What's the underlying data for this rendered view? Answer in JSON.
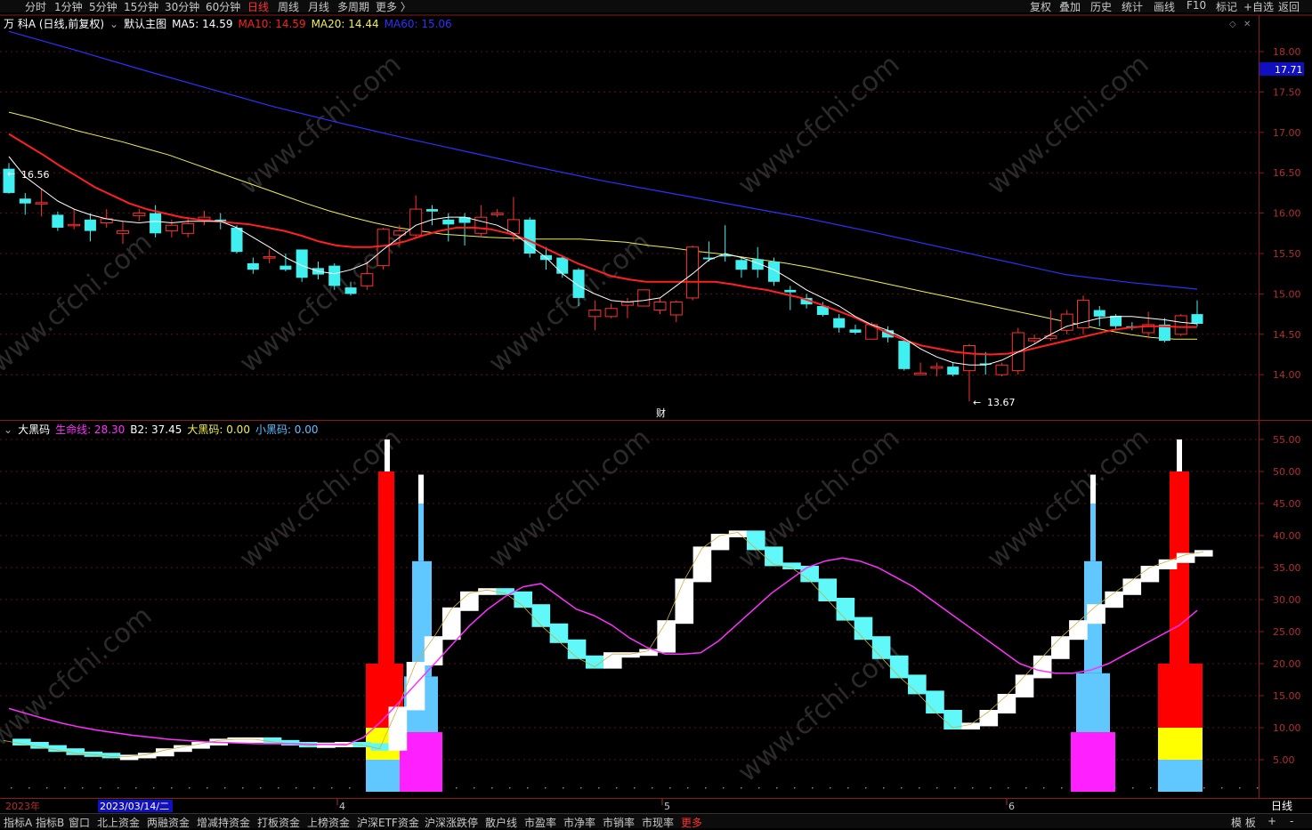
{
  "topbar": {
    "left": [
      "分时",
      "1分钟",
      "5分钟",
      "15分钟",
      "30分钟",
      "60分钟",
      "日线",
      "周线",
      "月线",
      "多周期",
      "更多 〉"
    ],
    "active": "日线",
    "right": [
      "复权",
      "叠加",
      "历史",
      "统计",
      "画线",
      "F10",
      "标记",
      "+自选",
      "返回"
    ]
  },
  "main_info": {
    "stock": "万 科A (日线,前复权)",
    "template": "默认主图",
    "ma5": "MA5: 14.59",
    "ma10": "MA10: 14.59",
    "ma20": "MA20: 14.44",
    "ma60": "MA60: 15.06"
  },
  "sub_info": {
    "name": "大黑码",
    "life": "生命线: 28.30",
    "b2": "B2: 37.45",
    "big": "大黑码: 0.00",
    "small": "小黑码: 0.00"
  },
  "price_axis": [
    "18.00",
    "17.50",
    "17.00",
    "16.50",
    "16.00",
    "15.50",
    "15.00",
    "14.50",
    "14.00"
  ],
  "price_tag": "17.71",
  "ind_axis": [
    "55.00",
    "50.00",
    "45.00",
    "40.00",
    "35.00",
    "30.00",
    "25.00",
    "20.00",
    "15.00",
    "10.00",
    "5.00"
  ],
  "annotations": {
    "high": "16.56",
    "low": "13.67",
    "fin": "财"
  },
  "date_axis": {
    "year": "2023年",
    "cursor": "2023/03/14/二",
    "m4": "4",
    "m5": "5",
    "m6": "6",
    "period": "日线"
  },
  "bottombar": {
    "items": [
      "指标A",
      "指标B",
      "窗口",
      "北上资金",
      "两融资金",
      "增减持资金",
      "打板资金",
      "上榜资金",
      "沪深ETF资金",
      "沪深涨跌停",
      "散户线",
      "市盈率",
      "市净率",
      "市销率",
      "市现率",
      "更多"
    ],
    "right": [
      "模 板",
      "+",
      "-"
    ]
  },
  "watermark": "www.cfchi.com",
  "colors": {
    "up": "#ff3030",
    "down": "#40f0f0",
    "ma5": "#ffffff",
    "ma10": "#ff2020",
    "ma20": "#f0f050",
    "ma60": "#3030ff",
    "life": "#ff30ff"
  },
  "chart_data": [
    {
      "type": "candlestick",
      "title": "万 科A (日线,前复权)",
      "ylim": [
        13.5,
        18.4
      ],
      "candles": [
        [
          16.55,
          16.25,
          16.62,
          16.24
        ],
        [
          16.18,
          16.12,
          16.25,
          15.98
        ],
        [
          16.12,
          16.13,
          16.3,
          15.96
        ],
        [
          15.98,
          15.82,
          16.02,
          15.78
        ],
        [
          15.85,
          15.86,
          16.05,
          15.8
        ],
        [
          15.92,
          15.78,
          16.0,
          15.65
        ],
        [
          15.88,
          15.93,
          16.05,
          15.82
        ],
        [
          15.75,
          15.78,
          15.9,
          15.62
        ],
        [
          15.97,
          16.0,
          16.05,
          15.9
        ],
        [
          16.0,
          15.75,
          16.1,
          15.7
        ],
        [
          15.78,
          15.85,
          15.92,
          15.7
        ],
        [
          15.75,
          15.87,
          15.95,
          15.7
        ],
        [
          15.92,
          15.95,
          16.03,
          15.85
        ],
        [
          15.92,
          15.9,
          16.0,
          15.8
        ],
        [
          15.82,
          15.52,
          15.85,
          15.5
        ],
        [
          15.38,
          15.3,
          15.45,
          15.25
        ],
        [
          15.45,
          15.46,
          15.55,
          15.38
        ],
        [
          15.35,
          15.3,
          15.5,
          15.28
        ],
        [
          15.55,
          15.2,
          15.55,
          15.15
        ],
        [
          15.32,
          15.24,
          15.4,
          15.18
        ],
        [
          15.35,
          15.1,
          15.38,
          15.05
        ],
        [
          15.08,
          15.0,
          15.15,
          14.98
        ],
        [
          15.1,
          15.25,
          15.4,
          15.05
        ],
        [
          15.35,
          15.8,
          15.82,
          15.3
        ],
        [
          15.73,
          15.78,
          15.85,
          15.6
        ],
        [
          15.73,
          16.05,
          16.22,
          15.7
        ],
        [
          16.05,
          16.02,
          16.1,
          15.85
        ],
        [
          15.92,
          15.86,
          16.0,
          15.65
        ],
        [
          15.95,
          15.88,
          16.0,
          15.6
        ],
        [
          15.75,
          15.95,
          16.1,
          15.7
        ],
        [
          15.98,
          16.0,
          16.05,
          15.95
        ],
        [
          15.75,
          15.92,
          16.2,
          15.65
        ],
        [
          15.92,
          15.5,
          15.95,
          15.45
        ],
        [
          15.48,
          15.42,
          15.58,
          15.3
        ],
        [
          15.45,
          15.25,
          15.48,
          15.2
        ],
        [
          15.3,
          14.95,
          15.32,
          14.85
        ],
        [
          14.72,
          14.8,
          14.92,
          14.55
        ],
        [
          14.72,
          14.82,
          14.88,
          14.7
        ],
        [
          14.86,
          14.9,
          14.95,
          14.7
        ],
        [
          14.85,
          15.05,
          15.05,
          14.85
        ],
        [
          14.8,
          14.9,
          14.95,
          14.75
        ],
        [
          14.74,
          14.9,
          14.92,
          14.65
        ],
        [
          14.95,
          15.58,
          15.6,
          14.92
        ],
        [
          15.45,
          15.43,
          15.65,
          15.4
        ],
        [
          15.48,
          15.47,
          15.85,
          15.4
        ],
        [
          15.42,
          15.3,
          15.45,
          15.2
        ],
        [
          15.43,
          15.3,
          15.58,
          15.2
        ],
        [
          15.4,
          15.15,
          15.45,
          15.1
        ],
        [
          15.05,
          15.02,
          15.1,
          14.8
        ],
        [
          14.95,
          14.87,
          15.0,
          14.82
        ],
        [
          14.85,
          14.74,
          14.9,
          14.72
        ],
        [
          14.7,
          14.58,
          14.75,
          14.52
        ],
        [
          14.56,
          14.52,
          14.62,
          14.5
        ],
        [
          14.44,
          14.62,
          14.65,
          14.44
        ],
        [
          14.55,
          14.46,
          14.6,
          14.4
        ],
        [
          14.42,
          14.07,
          14.45,
          14.05
        ],
        [
          14.0,
          14.02,
          14.15,
          14.0
        ],
        [
          14.08,
          14.1,
          14.15,
          13.98
        ],
        [
          14.1,
          14.0,
          14.15,
          13.98
        ],
        [
          14.05,
          14.36,
          14.38,
          13.67
        ],
        [
          14.14,
          14.13,
          14.28,
          14.0
        ],
        [
          14.0,
          14.12,
          14.15,
          13.98
        ],
        [
          14.05,
          14.52,
          14.58,
          14.0
        ],
        [
          14.42,
          14.45,
          14.5,
          14.38
        ],
        [
          14.45,
          14.48,
          14.8,
          14.42
        ],
        [
          14.55,
          14.75,
          14.8,
          14.5
        ],
        [
          14.58,
          14.92,
          14.98,
          14.5
        ],
        [
          14.8,
          14.72,
          14.85,
          14.6
        ],
        [
          14.73,
          14.6,
          14.75,
          14.55
        ],
        [
          14.6,
          14.58,
          14.65,
          14.55
        ],
        [
          14.52,
          14.62,
          14.78,
          14.45
        ],
        [
          14.62,
          14.42,
          14.7,
          14.4
        ],
        [
          14.5,
          14.73,
          14.75,
          14.48
        ],
        [
          14.75,
          14.63,
          14.92,
          14.6
        ]
      ],
      "ma5": [
        16.7,
        16.45,
        16.3,
        16.15,
        16.05,
        15.98,
        15.93,
        15.9,
        15.88,
        15.9,
        15.88,
        15.9,
        15.9,
        15.9,
        15.82,
        15.7,
        15.58,
        15.45,
        15.35,
        15.28,
        15.25,
        15.3,
        15.38,
        15.55,
        15.7,
        15.85,
        15.92,
        15.95,
        15.95,
        15.9,
        15.85,
        15.75,
        15.6,
        15.45,
        15.25,
        15.1,
        15.0,
        14.92,
        14.9,
        14.92,
        14.95,
        15.1,
        15.25,
        15.42,
        15.5,
        15.45,
        15.38,
        15.3,
        15.18,
        15.05,
        14.95,
        14.85,
        14.72,
        14.62,
        14.55,
        14.45,
        14.32,
        14.22,
        14.15,
        14.12,
        14.12,
        14.18,
        14.28,
        14.38,
        14.5,
        14.6,
        14.65,
        14.7,
        14.72,
        14.72,
        14.7,
        14.68,
        14.65,
        14.63
      ],
      "ma10": [
        16.98,
        16.85,
        16.72,
        16.58,
        16.45,
        16.32,
        16.22,
        16.12,
        16.05,
        16.0,
        15.95,
        15.92,
        15.9,
        15.88,
        15.86,
        15.82,
        15.78,
        15.72,
        15.65,
        15.6,
        15.58,
        15.58,
        15.6,
        15.65,
        15.72,
        15.78,
        15.82,
        15.82,
        15.8,
        15.75,
        15.68,
        15.58,
        15.48,
        15.38,
        15.3,
        15.22,
        15.18,
        15.15,
        15.15,
        15.15,
        15.15,
        15.15,
        15.12,
        15.08,
        15.05,
        15.0,
        14.95,
        14.88,
        14.8,
        14.72,
        14.62,
        14.52,
        14.43,
        14.36,
        14.32,
        14.28,
        14.26,
        14.25,
        14.26,
        14.3,
        14.35,
        14.4,
        14.45,
        14.5,
        14.55,
        14.58,
        14.6,
        14.6,
        14.59,
        14.59
      ],
      "ma20": [
        17.25,
        17.18,
        17.1,
        17.02,
        16.95,
        16.88,
        16.8,
        16.72,
        16.62,
        16.52,
        16.42,
        16.32,
        16.22,
        16.12,
        16.03,
        15.95,
        15.88,
        15.82,
        15.78,
        15.74,
        15.72,
        15.7,
        15.69,
        15.68,
        15.68,
        15.68,
        15.66,
        15.64,
        15.6,
        15.57,
        15.53,
        15.5,
        15.46,
        15.42,
        15.38,
        15.33,
        15.27,
        15.21,
        15.15,
        15.09,
        15.03,
        14.97,
        14.91,
        14.85,
        14.79,
        14.73,
        14.67,
        14.61,
        14.55,
        14.5,
        14.46,
        14.44,
        14.44
      ],
      "ma60": [
        18.25,
        18.02,
        17.78,
        17.55,
        17.32,
        17.12,
        16.93,
        16.75,
        16.57,
        16.4,
        16.25,
        16.1,
        15.95,
        15.78,
        15.6,
        15.42,
        15.24,
        15.14,
        15.06
      ],
      "marks": {
        "high": "16.56",
        "low": "13.67"
      }
    },
    {
      "type": "indicator",
      "title": "大黑码",
      "ylim": [
        0,
        57.5
      ],
      "series": [
        {
          "name": "生命线",
          "values": [
            13,
            12.2,
            11.4,
            10.7,
            10.1,
            9.6,
            9.2,
            8.8,
            8.5,
            8.2,
            8.0,
            7.8,
            7.7,
            7.6,
            7.5,
            7.5,
            7.5,
            7.4,
            7.4,
            7.3,
            8.5,
            11,
            14,
            17,
            20,
            23,
            26,
            28.5,
            30.5,
            32,
            32.5,
            30.5,
            28.5,
            27.5,
            26,
            24,
            22.5,
            21.5,
            21.5,
            21.7,
            23.5,
            26,
            28.5,
            31,
            33,
            35,
            36,
            36.5,
            36,
            35,
            33.5,
            32,
            30,
            28,
            26,
            24,
            22,
            20,
            19,
            18.5,
            18.5,
            19,
            20,
            21.5,
            23,
            24.5,
            26,
            28.3
          ]
        },
        {
          "name": "B2",
          "values": [
            8,
            7.5,
            7,
            6.5,
            6,
            5.8,
            5.5,
            5.5,
            5.8,
            6.5,
            7,
            7.5,
            8,
            8.2,
            8.2,
            7.8,
            7.5,
            7.2,
            7.4,
            7.5,
            7.3,
            6.7,
            13,
            20,
            24,
            28.5,
            31,
            31.5,
            31,
            29,
            26,
            23.5,
            21,
            19.5,
            21.5,
            21.5,
            22,
            26.5,
            33,
            38,
            40,
            40.5,
            38,
            35.5,
            35,
            33,
            30,
            27,
            24,
            21,
            18,
            15.5,
            12.5,
            10,
            10.5,
            12.5,
            15,
            18,
            21,
            24,
            26.5,
            29,
            31,
            33,
            35,
            36,
            37,
            37.45
          ]
        },
        {
          "name": "大黑码",
          "values": [
            0
          ]
        },
        {
          "name": "小黑码",
          "values": [
            0
          ]
        }
      ]
    }
  ]
}
